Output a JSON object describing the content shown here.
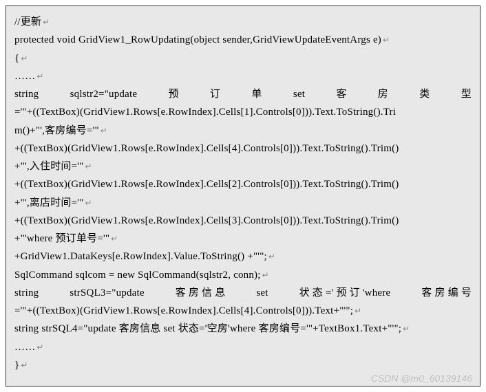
{
  "code": {
    "line1": "//更新",
    "line2": "protected void GridView1_RowUpdating(object sender,GridViewUpdateEventArgs e)",
    "line3": "{",
    "line4": "……",
    "line5_parts": [
      "string",
      "sqlstr2=\"update",
      "预",
      "订",
      "单",
      "set",
      "客",
      "房",
      "类",
      "型"
    ],
    "line6": "='\"+((TextBox)(GridView1.Rows[e.RowIndex].Cells[1].Controls[0])).Text.ToString().Tri",
    "line7": "m()+\"',客房编号='\"",
    "line8": "+((TextBox)(GridView1.Rows[e.RowIndex].Cells[4].Controls[0])).Text.ToString().Trim()",
    "line9": "+\"',入住时间='\"",
    "line10": "+((TextBox)(GridView1.Rows[e.RowIndex].Cells[2].Controls[0])).Text.ToString().Trim()",
    "line11": "+\"',离店时间='\"",
    "line12": "+((TextBox)(GridView1.Rows[e.RowIndex].Cells[3].Controls[0])).Text.ToString().Trim()",
    "line13": "+\"'where  预订单号='\"",
    "line14": "+GridView1.DataKeys[e.RowIndex].Value.ToString() +\"'\";",
    "line15": "SqlCommand sqlcom = new SqlCommand(sqlstr2, conn);",
    "line16_parts": [
      "string",
      "strSQL3=\"update",
      "客 房 信 息",
      "set",
      "状 态 =' 预 订 'where",
      "客 房 编 号"
    ],
    "line17": "='\"+((TextBox)(GridView1.Rows[e.RowIndex].Cells[4].Controls[0])).Text+\"'\";",
    "line18": "string strSQL4=\"update 客房信息 set 状态='空房'where 客房编号='\"+TextBox1.Text+\"'\";",
    "line19": "……",
    "line20": "}"
  },
  "return_symbol": "↵",
  "watermark": "CSDN @m0_60139146"
}
